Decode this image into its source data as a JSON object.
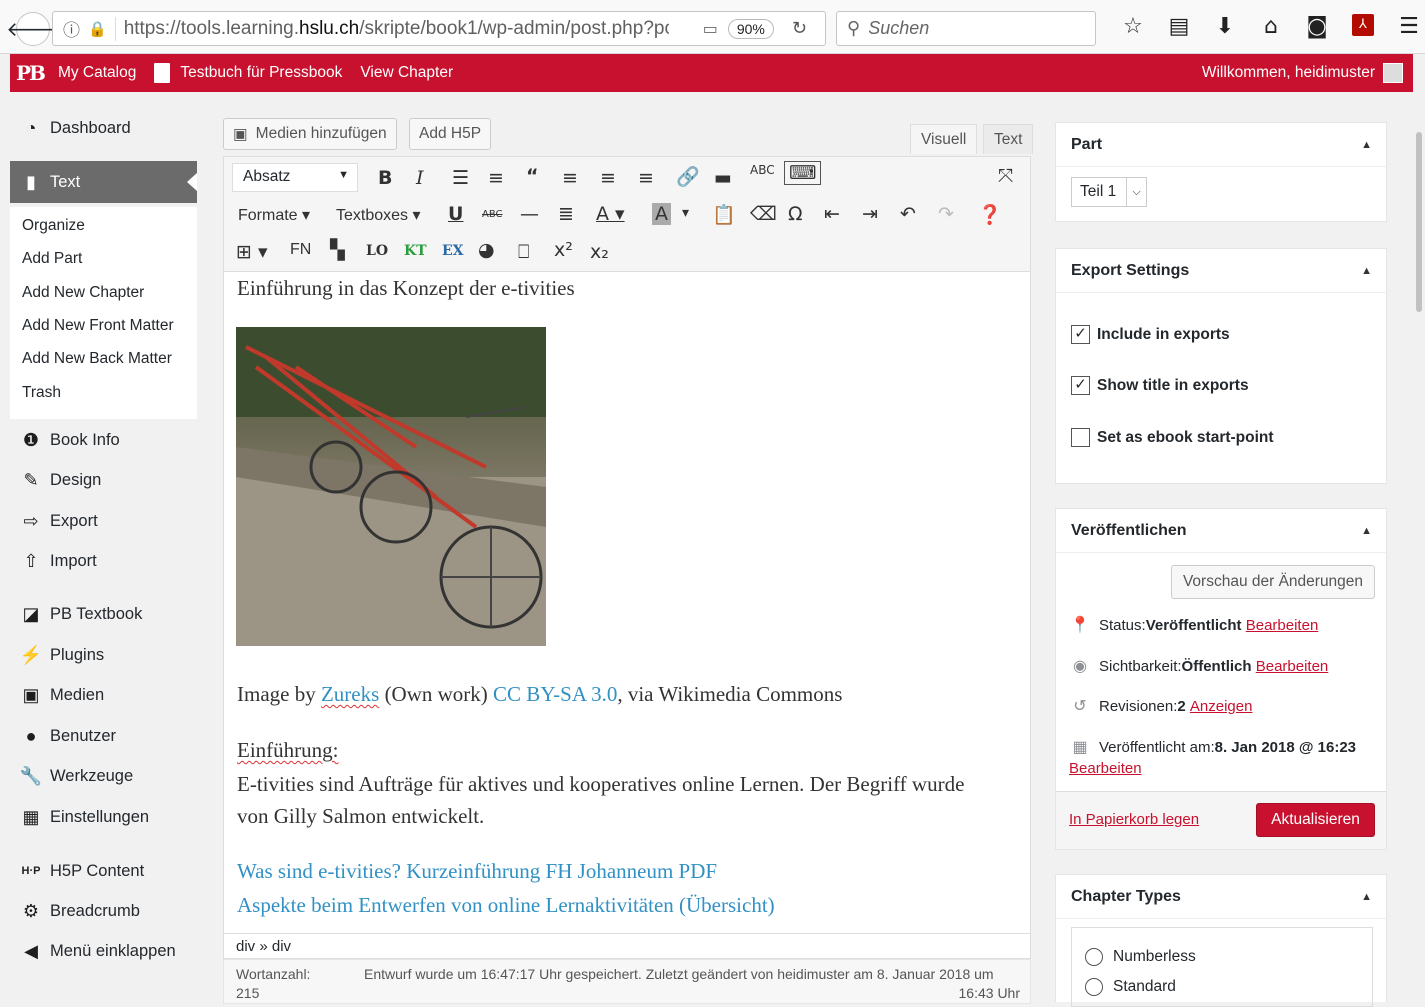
{
  "browser": {
    "url_prefix": "https://tools.learning.",
    "url_domain": "hslu.ch",
    "url_path": "/skripte/book1/wp-admin/post.php?po",
    "zoom": "90%",
    "search_placeholder": "Suchen"
  },
  "adminbar": {
    "logo": "PB",
    "my_catalog": "My Catalog",
    "book_title": "Testbuch für Pressbook",
    "view_chapter": "View Chapter",
    "welcome": "Willkommen, heidimuster"
  },
  "sidebar": {
    "dashboard": "Dashboard",
    "text": "Text",
    "submenu": [
      "Organize",
      "Add Part",
      "Add New Chapter",
      "Add New Front Matter",
      "Add New Back Matter",
      "Trash"
    ],
    "book_info": "Book Info",
    "design": "Design",
    "export": "Export",
    "import": "Import",
    "pb_textbook": "PB Textbook",
    "plugins": "Plugins",
    "medien": "Medien",
    "benutzer": "Benutzer",
    "werkzeuge": "Werkzeuge",
    "einstellungen": "Einstellungen",
    "h5p_content": "H5P Content",
    "breadcrumb": "Breadcrumb",
    "collapse": "Menü einklappen"
  },
  "editor": {
    "add_media": "Medien hinzufügen",
    "add_h5p": "Add H5P",
    "tab_visual": "Visuell",
    "tab_text": "Text",
    "format_select": "Absatz",
    "formats": "Formate",
    "textboxes": "Textboxes",
    "fn": "FN",
    "lo": "LO",
    "kt": "KT",
    "ex": "EX",
    "heading": "Einführung in das Konzept der e-tivities",
    "image_credit_pre": "Image by ",
    "image_credit_author": "Zureks",
    "image_credit_mid": " (Own work) ",
    "image_credit_license": "CC BY-SA 3.0",
    "image_credit_post": ", via Wikimedia Commons",
    "intro_label": "Einführung:",
    "intro_line1": "E-tivities sind Aufträge für aktives und kooperatives online Lernen. Der Begriff wurde",
    "intro_line2": "von Gilly Salmon entwickelt.",
    "link1": "Was sind e-tivities? Kurzeinführung FH Johanneum PDF",
    "link2": "Aspekte beim Entwerfen von online Lernaktivitäten (Übersicht)",
    "path": "div » div",
    "word_count_label": "Wortanzahl:",
    "word_count": "215",
    "autosave_line1": "Entwurf wurde um 16:47:17 Uhr gespeichert. Zuletzt geändert von heidimuster am 8. Januar 2018 um",
    "autosave_line2": "16:43 Uhr"
  },
  "part_box": {
    "title": "Part",
    "selected": "Teil 1"
  },
  "export_box": {
    "title": "Export Settings",
    "include": "Include in exports",
    "include_checked": true,
    "show_title": "Show title in exports",
    "show_title_checked": true,
    "start_point": "Set as ebook start-point",
    "start_point_checked": false
  },
  "publish_box": {
    "title": "Veröffentlichen",
    "preview": "Vorschau der Änderungen",
    "status_label": "Status: ",
    "status_value": "Veröffentlicht",
    "edit": "Bearbeiten",
    "visibility_label": "Sichtbarkeit: ",
    "visibility_value": "Öffentlich",
    "revisions_label": "Revisionen: ",
    "revisions_value": "2",
    "revisions_link": "Anzeigen",
    "published_label": "Veröffentlicht am: ",
    "published_value": "8. Jan 2018 @ 16:23",
    "trash": "In Papierkorb legen",
    "update": "Aktualisieren",
    "accent_color": "#c7112e"
  },
  "chapter_types_box": {
    "title": "Chapter Types",
    "options": [
      "Numberless",
      "Standard"
    ]
  },
  "colors": {
    "brand": "#c7112e",
    "link": "#3191c4"
  }
}
